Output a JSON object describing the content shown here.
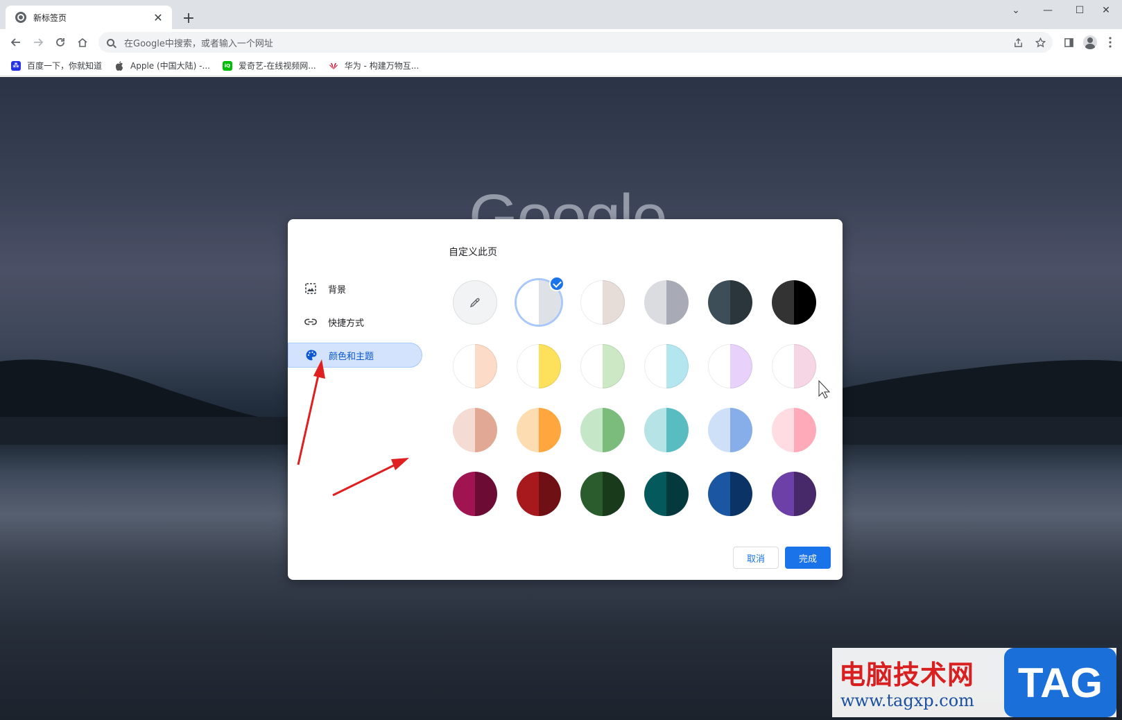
{
  "browser": {
    "tab_title": "新标签页",
    "tab_close": "✕",
    "new_tab": "+",
    "window_controls": {
      "tab_search": "⌄",
      "minimize": "—",
      "maximize": "☐",
      "close": "✕"
    },
    "omnibox_placeholder": "在Google中搜索，或者输入一个网址",
    "icons": {
      "back": "back-icon",
      "forward": "forward-icon",
      "reload": "reload-icon",
      "home": "home-icon",
      "share": "share-icon",
      "star": "star-icon",
      "side-panel": "side-panel-icon",
      "profile": "profile-icon",
      "menu": "more-vert-icon"
    }
  },
  "bookmarks": [
    {
      "label": "百度一下，你就知道",
      "color": "#2932e1"
    },
    {
      "label": "Apple (中国大陆) -...",
      "color": "#555555"
    },
    {
      "label": "爱奇艺-在线视频网...",
      "color": "#00be06"
    },
    {
      "label": "华为 - 构建万物互...",
      "color": "#cf0a2c"
    }
  ],
  "page": {
    "logo_text": "Google"
  },
  "dialog": {
    "title": "自定义此页",
    "sidebar": [
      {
        "label": "背景",
        "icon": "image-icon",
        "selected": false
      },
      {
        "label": "快捷方式",
        "icon": "link-icon",
        "selected": false
      },
      {
        "label": "颜色和主题",
        "icon": "palette-icon",
        "selected": true
      }
    ],
    "color_rows": [
      [
        {
          "left": "#f1f3f4",
          "right": "#f1f3f4",
          "type": "picker"
        },
        {
          "left": "#ffffff",
          "right": "#dee1e6",
          "selected": true
        },
        {
          "left": "#ffffff",
          "right": "#e6dcd8"
        },
        {
          "left": "#dadce0",
          "right": "#a8abb6"
        },
        {
          "left": "#3e4e58",
          "right": "#2a353c"
        },
        {
          "left": "#333333",
          "right": "#000000"
        }
      ],
      [
        {
          "left": "#ffffff",
          "right": "#fcdbc8"
        },
        {
          "left": "#ffffff",
          "right": "#fde05c"
        },
        {
          "left": "#ffffff",
          "right": "#cce8c4"
        },
        {
          "left": "#ffffff",
          "right": "#b4e6f0"
        },
        {
          "left": "#ffffff",
          "right": "#e8d2fc"
        },
        {
          "left": "#ffffff",
          "right": "#f6d6e4"
        }
      ],
      [
        {
          "left": "#f4dcd4",
          "right": "#e2a896"
        },
        {
          "left": "#fedcb2",
          "right": "#ffa63e"
        },
        {
          "left": "#c6e6c8",
          "right": "#7bbb7c"
        },
        {
          "left": "#b6e4e6",
          "right": "#58bcc0"
        },
        {
          "left": "#cde0f8",
          "right": "#88aeea"
        },
        {
          "left": "#ffdce2",
          "right": "#ffaab8"
        }
      ],
      [
        {
          "left": "#a01452",
          "right": "#6c0c34"
        },
        {
          "left": "#a8191e",
          "right": "#6e1014"
        },
        {
          "left": "#2a5c2e",
          "right": "#1a3a1c"
        },
        {
          "left": "#04595c",
          "right": "#043a3e"
        },
        {
          "left": "#1a56a2",
          "right": "#0c3366"
        },
        {
          "left": "#6c40a6",
          "right": "#472868"
        }
      ]
    ],
    "cancel_label": "取消",
    "done_label": "完成"
  },
  "annotation_color": "#e02020",
  "watermark": {
    "cn_text": "电脑技术网",
    "url": "www.tagxp.com",
    "tag": "TAG"
  }
}
